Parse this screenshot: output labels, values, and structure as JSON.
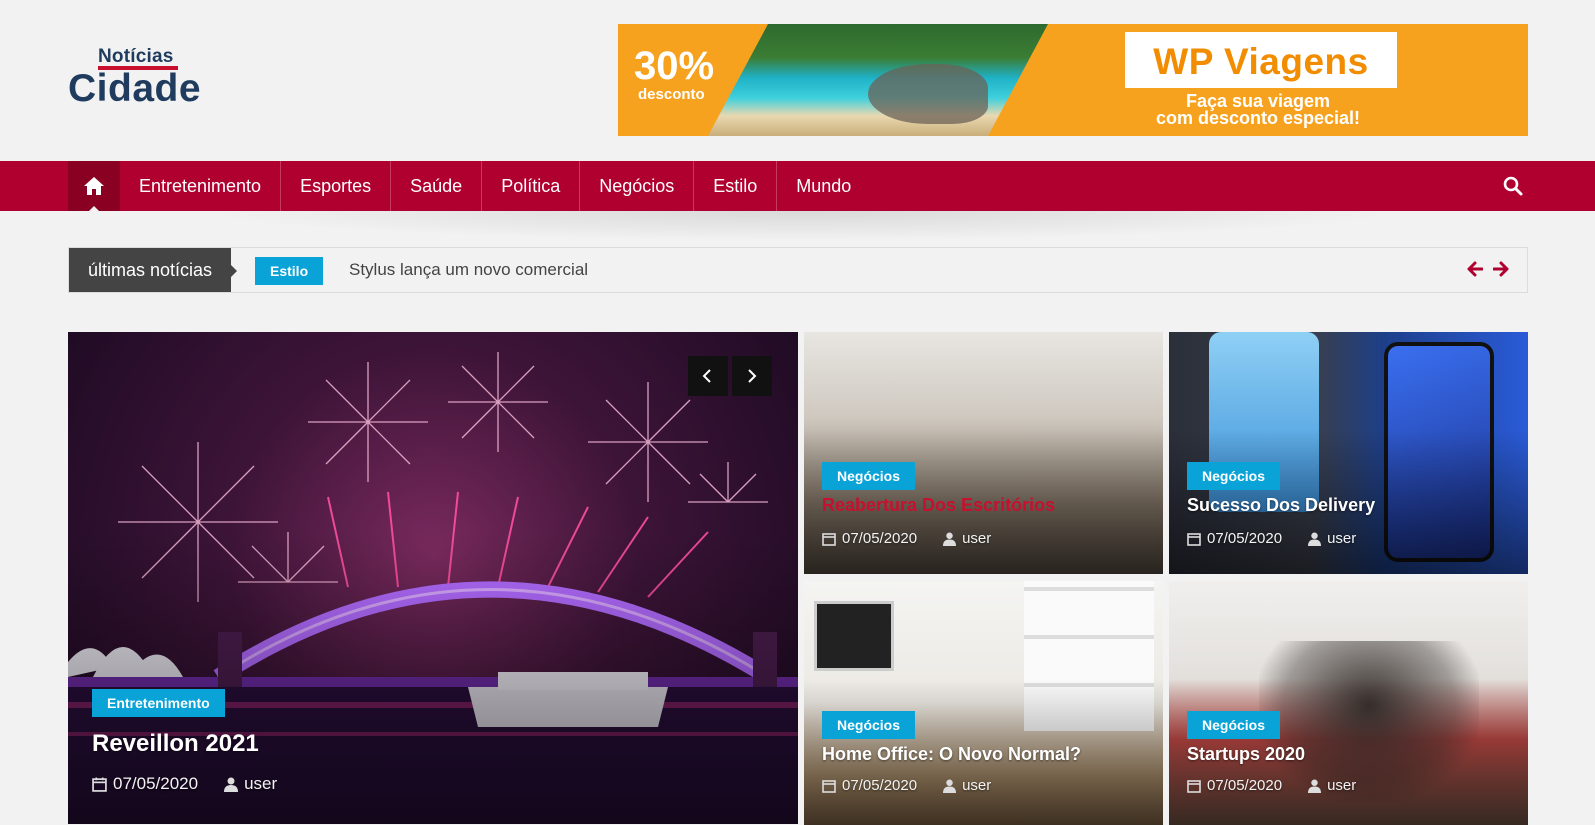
{
  "logo": {
    "line1": "Notícias",
    "line2": "Cidade"
  },
  "banner": {
    "discount": "30%",
    "discount_label": "desconto",
    "brand": "WP Viagens",
    "tagline1": "Faça sua viagem",
    "tagline2": "com desconto especial!"
  },
  "nav": {
    "items": [
      "Entretenimento",
      "Esportes",
      "Saúde",
      "Política",
      "Negócios",
      "Estilo",
      "Mundo"
    ]
  },
  "ticker": {
    "label": "últimas notícias",
    "tag": "Estilo",
    "text": "Stylus lança um novo comercial"
  },
  "featured": {
    "category": "Entretenimento",
    "title": "Reveillon 2021",
    "date": "07/05/2020",
    "author": "user"
  },
  "cards": [
    {
      "category": "Negócios",
      "title": "Reabertura Dos Escritórios",
      "date": "07/05/2020",
      "author": "user"
    },
    {
      "category": "Negócios",
      "title": "Sucesso Dos Delivery",
      "date": "07/05/2020",
      "author": "user"
    },
    {
      "category": "Negócios",
      "title": "Home Office: O Novo Normal?",
      "date": "07/05/2020",
      "author": "user"
    },
    {
      "category": "Negócios",
      "title": "Startups 2020",
      "date": "07/05/2020",
      "author": "user"
    }
  ],
  "colors": {
    "brand_red": "#b0002f",
    "tag_blue": "#0aa3d8",
    "hover_title": "#c8102e"
  },
  "icons": [
    "home-icon",
    "search-icon",
    "calendar-icon",
    "user-icon",
    "arrow-left-icon",
    "arrow-right-icon",
    "chevron-left-icon",
    "chevron-right-icon"
  ]
}
